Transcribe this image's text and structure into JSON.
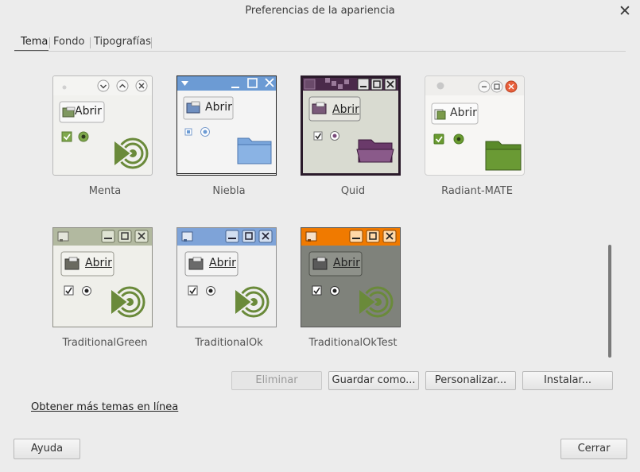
{
  "window": {
    "title": "Preferencias de la apariencia"
  },
  "tabs": [
    {
      "label": "Tema"
    },
    {
      "label": "Fondo"
    },
    {
      "label": "Tipografías"
    }
  ],
  "themes": [
    {
      "name": "Menta",
      "button": "Abrir"
    },
    {
      "name": "Niebla",
      "button": "Abrir"
    },
    {
      "name": "Quid",
      "button": "Abrir"
    },
    {
      "name": "Radiant-MATE",
      "button": "Abrir"
    },
    {
      "name": "TraditionalGreen",
      "button": "Abrir"
    },
    {
      "name": "TraditionalOk",
      "button": "Abrir"
    },
    {
      "name": "TraditionalOkTest",
      "button": "Abrir"
    }
  ],
  "actions": {
    "eliminar": "Eliminar",
    "guardar": "Guardar como...",
    "personalizar": "Personalizar...",
    "instalar": "Instalar..."
  },
  "link": {
    "text": "Obtener más temas en línea"
  },
  "footer": {
    "help": "Ayuda",
    "close": "Cerrar"
  },
  "colors": {
    "accent_green": "#6a8a3a",
    "niebla_blue": "#6c9bd4",
    "quid_purple": "#5a2d5a",
    "ok_blue": "#6f9ad6",
    "oktest_orange": "#f07a00"
  }
}
